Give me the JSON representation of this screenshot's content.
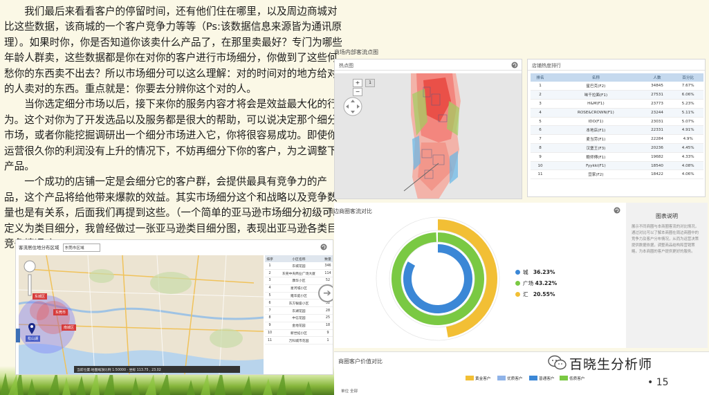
{
  "article": {
    "paragraphs": [
      "我们最后来看看客户的停留时间，还有他们住在哪里，以及周边商城对比这些数据，该商城的一个客户竞争力等等（Ps:该数据信息来源皆为通讯原理）。如果时你，你是否知道你该卖什么产品了，在那里卖最好？专门为哪些年龄人群卖，这些数据都是你在对你的客户进行市场细分，你做到了这些何愁你的东西卖不出去？所以市场细分可以这么理解：对的时间对的地方给对的人卖对的东西。重点就是：你要去分辨你这个对的人。",
      "当你选定细分市场以后，接下来你的服务内容才将会是效益最大化的行为。这个对你为了开发选品以及服务都是很大的帮助，可以说决定那个细分市场，或者你能挖掘调研出一个细分市场进入它，你将很容易成功。即使你运营很久你的利润没有上升的情况下，不妨再细分下你的客户，为之调整下产品。",
      "一个成功的店铺一定是会细分它的客户群，会提供最具有竞争力的产品，这个产品将给他带来爆款的效益。其实市场细分这个和战略以及竞争数量也是有关系，后面我们再提到这些。（一个简单的亚马逊市场细分初级可以定义为类目细分，我曾经做过一张亚马逊类目细分图，表现出亚马逊各类目竞争情况。）"
    ]
  },
  "heat_panel": {
    "section_title": "商场内部客流点图",
    "title": "热点图",
    "zoom_level": "1"
  },
  "rank_panel": {
    "title": "店铺热度排行",
    "headers": [
      "排名",
      "名称",
      "人数",
      "百分比"
    ],
    "rows": [
      [
        "1",
        "星巴克(F2)",
        "34845",
        "7.67%"
      ],
      [
        "2",
        "味千拉面(F1)",
        "27531",
        "6.06%"
      ],
      [
        "3",
        "H&M(F1)",
        "23773",
        "5.23%"
      ],
      [
        "4",
        "ROSE&CROWN(F1)",
        "23244",
        "5.11%"
      ],
      [
        "5",
        "IDO(F1)",
        "23031",
        "5.07%"
      ],
      [
        "6",
        "本地店(F1)",
        "22331",
        "4.91%"
      ],
      [
        "7",
        "麦当劳(F1)",
        "22284",
        "4.9%"
      ],
      [
        "8",
        "汉堡王(F3)",
        "20236",
        "4.45%"
      ],
      [
        "9",
        "鲍师傅(F1)",
        "19682",
        "4.33%"
      ],
      [
        "10",
        "Fyykki(F1)",
        "18540",
        "4.08%"
      ],
      [
        "11",
        "宜家(F2)",
        "18422",
        "4.06%"
      ]
    ]
  },
  "donut_panel": {
    "title": "周边商圈客流对比",
    "info_title": "图表说明",
    "info_text": "展示不同商圈与本商圈客流的对比情况，通过对比可以了解本商圈在周边商圈中的竞争力及客户分布情况，从而为运营决策提供数据依据，调整商品结构和营销策略，为本商圈的客户提供更好的服务。",
    "legend": [
      {
        "name": "城",
        "value": "36.23%",
        "color": "#3b87d6"
      },
      {
        "name": "广场",
        "value": "43.22%",
        "color": "#7ac943"
      },
      {
        "name": "汇",
        "value": "20.55%",
        "color": "#f2bf35"
      }
    ]
  },
  "value_panel": {
    "title": "商圈客户价值对比",
    "legend": [
      {
        "name": "黄金客户",
        "color": "#f2bf35"
      },
      {
        "name": "优质客户",
        "color": "#8fb3e8"
      },
      {
        "name": "普通客户",
        "color": "#3b87d6"
      },
      {
        "name": "低质客户",
        "color": "#7ac943"
      }
    ],
    "toolbar": "单位   全部"
  },
  "lmap_panel": {
    "title": "客流居住地分布区域",
    "select_value": "东莞市区域",
    "headers": [
      "排序",
      "小区名称",
      "数量"
    ],
    "rows": [
      [
        "1",
        "东城花园",
        "346"
      ],
      [
        "2",
        "东莞中央商业广场大厦",
        "114"
      ],
      [
        "3",
        "康华小区",
        "52"
      ],
      [
        "4",
        "星河城小区",
        "41"
      ],
      [
        "5",
        "雍华庭小区",
        "38"
      ],
      [
        "6",
        "东方银座小区",
        "32"
      ],
      [
        "7",
        "东湖花园",
        "28"
      ],
      [
        "8",
        "中信花园",
        "25"
      ],
      [
        "9",
        "金地花园",
        "18"
      ],
      [
        "10",
        "新世纪小区",
        "9"
      ],
      [
        "11",
        "万科城市花园",
        "1"
      ]
    ],
    "pin_labels": [
      "东城区",
      "东莞市",
      "南城区",
      "松山湖"
    ],
    "status": "当前位置:地图缩放比例 1:50000 · 坐标 113.75 , 23.02"
  },
  "brand": {
    "name": "百晓生分析师",
    "icon": "wechat-icon"
  },
  "page_number": "15"
}
